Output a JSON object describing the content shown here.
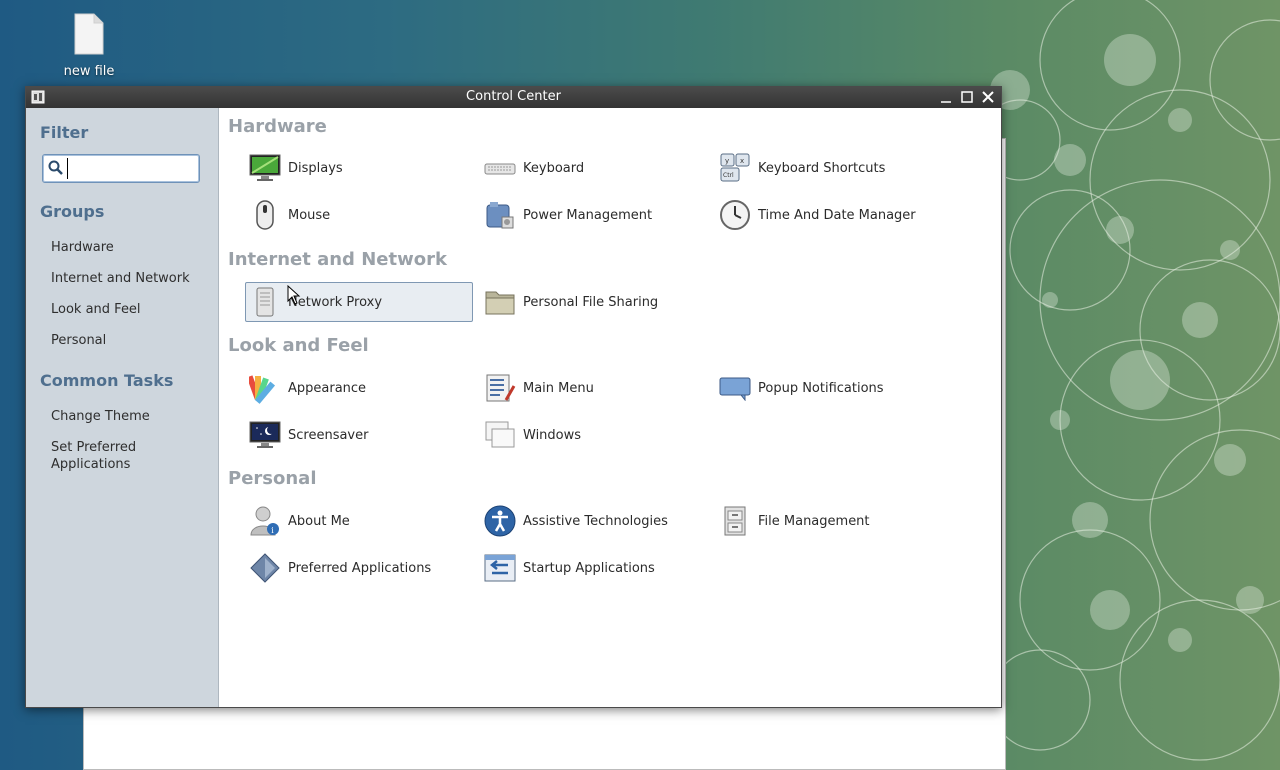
{
  "desktop": {
    "file_icon_label": "new file"
  },
  "window": {
    "title": "Control Center",
    "controls": {
      "minimize": "minimize-icon",
      "maximize": "maximize-icon",
      "close": "close-icon"
    }
  },
  "sidebar": {
    "filter_heading": "Filter",
    "search": {
      "value": "",
      "placeholder": ""
    },
    "groups_heading": "Groups",
    "groups": [
      "Hardware",
      "Internet and Network",
      "Look and Feel",
      "Personal"
    ],
    "tasks_heading": "Common Tasks",
    "tasks": [
      "Change Theme",
      "Set Preferred Applications"
    ]
  },
  "sections": [
    {
      "title": "Hardware",
      "items": [
        {
          "label": "Displays",
          "icon": "display-icon"
        },
        {
          "label": "Keyboard",
          "icon": "keyboard-icon"
        },
        {
          "label": "Keyboard Shortcuts",
          "icon": "keyboard-shortcuts-icon"
        },
        {
          "label": "Mouse",
          "icon": "mouse-icon"
        },
        {
          "label": "Power Management",
          "icon": "power-management-icon"
        },
        {
          "label": "Time And Date Manager",
          "icon": "clock-icon"
        }
      ]
    },
    {
      "title": "Internet and Network",
      "items": [
        {
          "label": "Network Proxy",
          "icon": "network-proxy-icon",
          "selected": true
        },
        {
          "label": "Personal File Sharing",
          "icon": "folder-share-icon"
        }
      ]
    },
    {
      "title": "Look and Feel",
      "items": [
        {
          "label": "Appearance",
          "icon": "appearance-icon"
        },
        {
          "label": "Main Menu",
          "icon": "main-menu-icon"
        },
        {
          "label": "Popup Notifications",
          "icon": "notification-icon"
        },
        {
          "label": "Screensaver",
          "icon": "screensaver-icon"
        },
        {
          "label": "Windows",
          "icon": "windows-icon"
        }
      ]
    },
    {
      "title": "Personal",
      "items": [
        {
          "label": "About Me",
          "icon": "about-me-icon"
        },
        {
          "label": "Assistive Technologies",
          "icon": "accessibility-icon"
        },
        {
          "label": "File Management",
          "icon": "file-cabinet-icon"
        },
        {
          "label": "Preferred Applications",
          "icon": "preferred-apps-icon"
        },
        {
          "label": "Startup Applications",
          "icon": "startup-apps-icon"
        }
      ]
    }
  ]
}
